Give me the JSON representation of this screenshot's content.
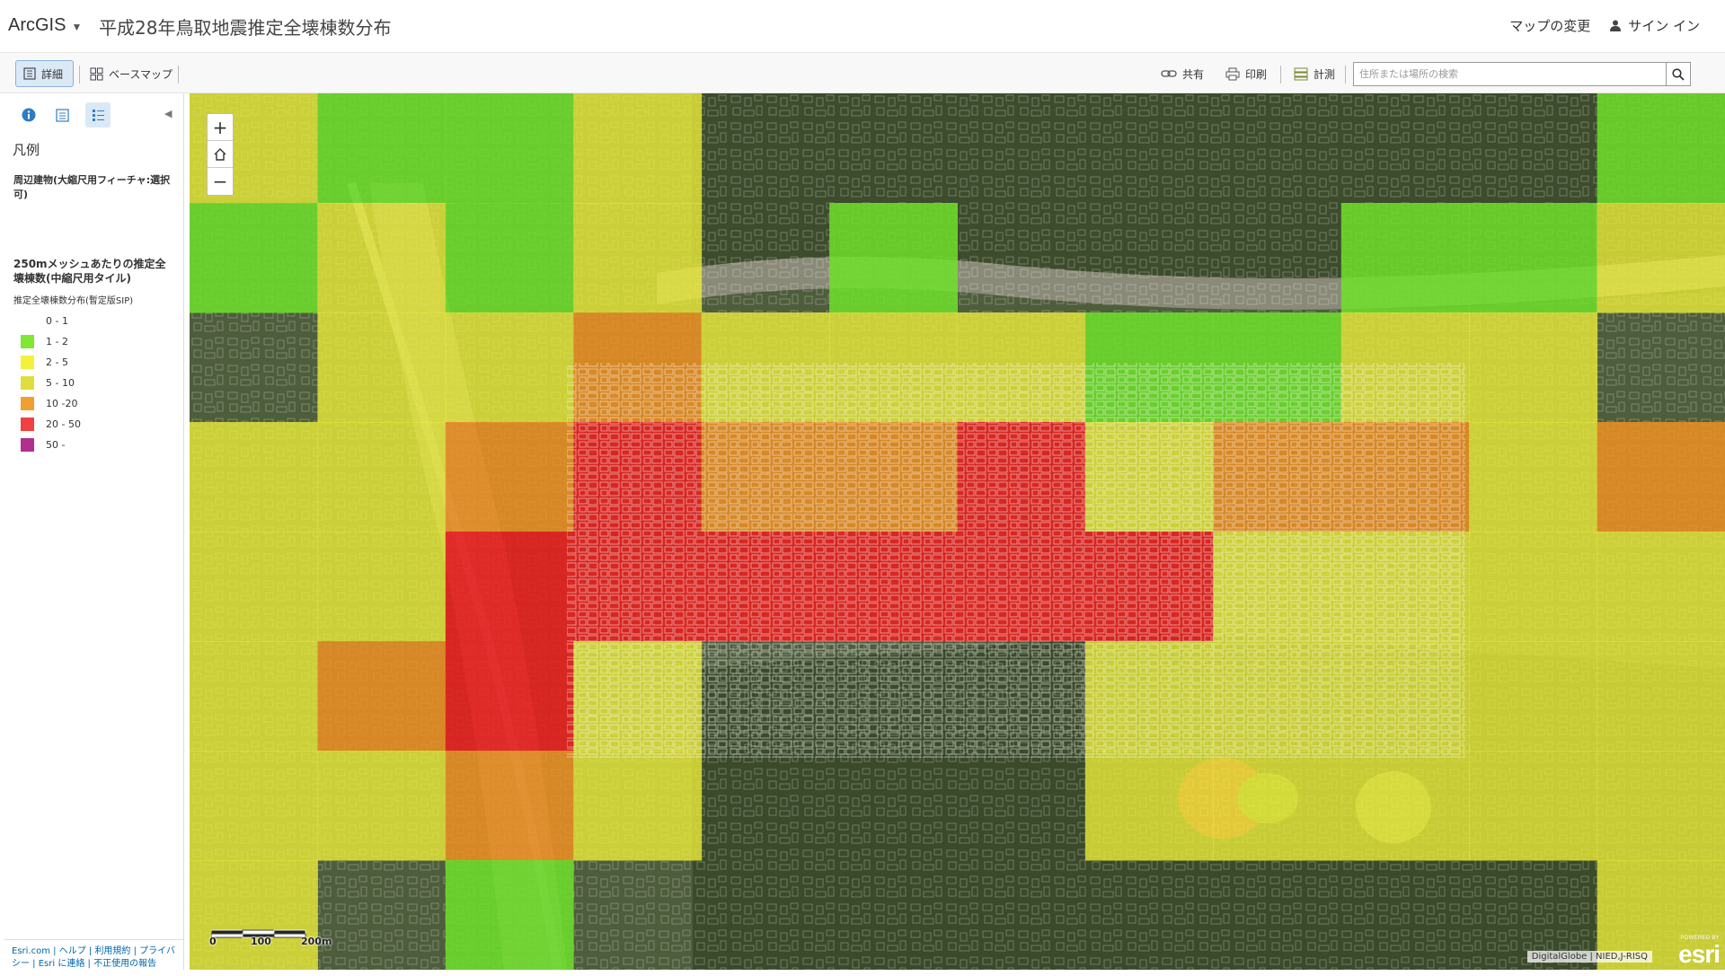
{
  "header": {
    "brand": "ArcGIS",
    "title": "平成28年鳥取地震推定全壊棟数分布",
    "change_map": "マップの変更",
    "sign_in": "サイン イン"
  },
  "toolbar": {
    "details": "詳細",
    "basemap": "ベースマップ",
    "share": "共有",
    "print": "印刷",
    "measure": "計測",
    "search_placeholder": "住所または場所の検索"
  },
  "panel": {
    "legend_heading": "凡例",
    "layer1_title": "周辺建物(大縮尺用フィーチャ:選択可)",
    "layer2_title": "250mメッシュあたりの推定全壊棟数(中縮尺用タイル)",
    "layer2_subtitle": "推定全壊棟数分布(暫定版SIP)",
    "legend_items": [
      {
        "label": "0 - 1",
        "color": "transparent"
      },
      {
        "label": "1 - 2",
        "color": "#7fe832"
      },
      {
        "label": "2 - 5",
        "color": "#f2f23a"
      },
      {
        "label": "5 - 10",
        "color": "#dede3c"
      },
      {
        "label": "10 -20",
        "color": "#f0a030"
      },
      {
        "label": "20 - 50",
        "color": "#f04040"
      },
      {
        "label": "50 -",
        "color": "#b03090"
      }
    ],
    "footer": {
      "esri": "Esri.com",
      "help": "ヘルプ",
      "terms": "利用規約",
      "privacy": "プライバシー",
      "contact": "Esri に連絡",
      "report": "不正使用の報告"
    }
  },
  "map": {
    "zoom_in": "+",
    "zoom_out": "−",
    "scale_labels": [
      "0",
      "100",
      "200m"
    ],
    "attribution": "DigitalGlobe | NIED,J-RISQ",
    "esri_powered": "POWERED BY",
    "esri_word": "esri",
    "colors": {
      "green": "#6fe02a",
      "yellow": "#eef03a",
      "olive": "#d8dc2e",
      "orange": "#ee8f22",
      "red": "#ee1c1c"
    },
    "grid": {
      "cols": 12,
      "rows": 8,
      "cells": [
        "Y G G Y . . . . . . . G",
        "G Y G Y . G . . . G G Y",
        ". Y Y O Y Y Y G G Y Y .",
        "Y Y O R O O R Y O O Y O",
        "Y Y R R R R R R Y Y Y Y",
        "Y O R Y . . . Y Y Y Y Y",
        "Y Y O Y . . . Y Y Y Y Y",
        "Y . G . . . . . . . . Y"
      ]
    }
  }
}
